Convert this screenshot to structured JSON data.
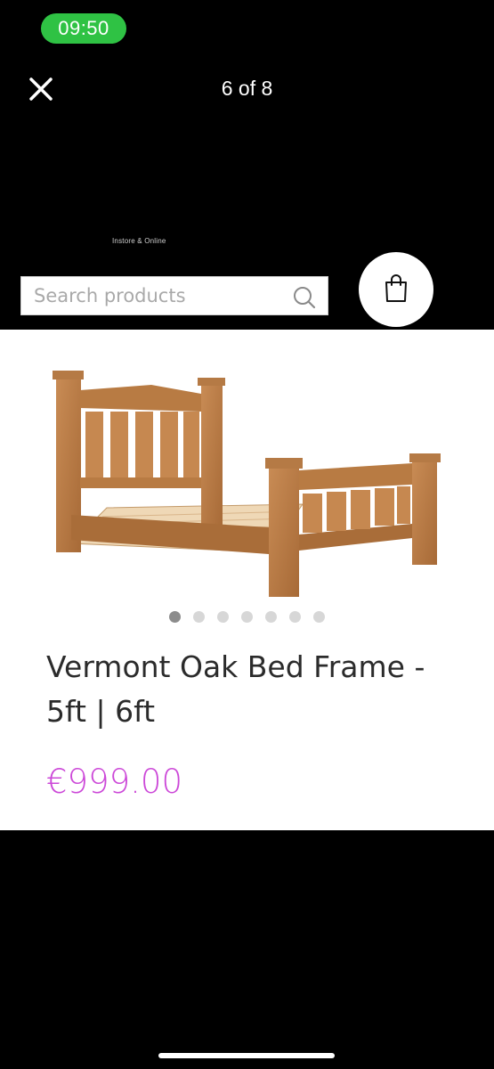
{
  "status_bar": {
    "time": "09:50",
    "pill_color": "#2fc244"
  },
  "viewer": {
    "close_icon": "close-icon",
    "counter": "6 of 8"
  },
  "header": {
    "tagline": "Instore & Online",
    "search": {
      "placeholder": "Search products",
      "value": "",
      "icon": "search-icon"
    },
    "cart_icon": "shopping-bag-icon"
  },
  "product": {
    "image_alt": "Vermont Oak Bed Frame",
    "carousel": {
      "total": 7,
      "active_index": 0
    },
    "title": "Vermont Oak Bed Frame - 5ft | 6ft",
    "price": "€999.00",
    "price_color": "#cc48d8"
  }
}
